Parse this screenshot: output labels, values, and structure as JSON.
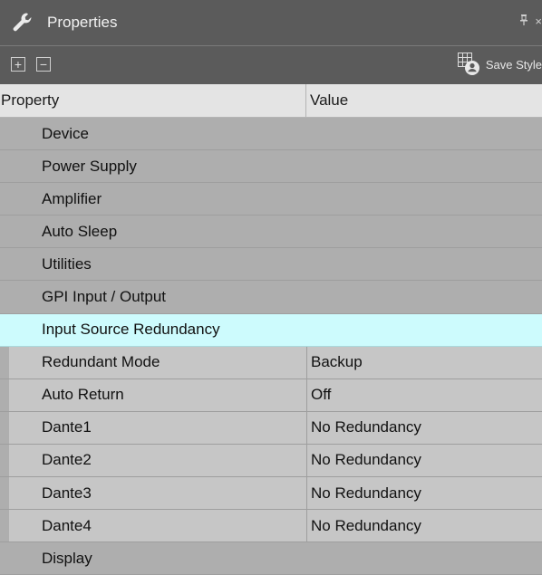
{
  "titlebar": {
    "title": "Properties",
    "icon": "wrench-icon",
    "pin_icon": "pin-icon",
    "close_glyph": "×"
  },
  "toolbar": {
    "expand_glyph": "+",
    "collapse_glyph": "−",
    "save_style_label": "Save Style"
  },
  "grid": {
    "header": {
      "property": "Property",
      "value": "Value"
    },
    "rows": [
      {
        "kind": "category",
        "name": "Device"
      },
      {
        "kind": "category",
        "name": "Power Supply"
      },
      {
        "kind": "category",
        "name": "Amplifier"
      },
      {
        "kind": "category",
        "name": "Auto Sleep"
      },
      {
        "kind": "category",
        "name": "Utilities"
      },
      {
        "kind": "category",
        "name": "GPI Input / Output"
      },
      {
        "kind": "selected",
        "name": "Input Source Redundancy"
      },
      {
        "kind": "property",
        "name": "Redundant Mode",
        "value": "Backup"
      },
      {
        "kind": "property",
        "name": "Auto Return",
        "value": "Off"
      },
      {
        "kind": "property",
        "name": "Dante1",
        "value": "No Redundancy"
      },
      {
        "kind": "property",
        "name": "Dante2",
        "value": "No Redundancy"
      },
      {
        "kind": "property",
        "name": "Dante3",
        "value": "No Redundancy"
      },
      {
        "kind": "property",
        "name": "Dante4",
        "value": "No Redundancy"
      },
      {
        "kind": "category",
        "name": "Display"
      }
    ]
  },
  "colors": {
    "titlebar_bg": "#5b5b5b",
    "category_bg": "#aeaeae",
    "property_bg": "#c6c6c6",
    "selected_bg": "#cdfbfd"
  }
}
